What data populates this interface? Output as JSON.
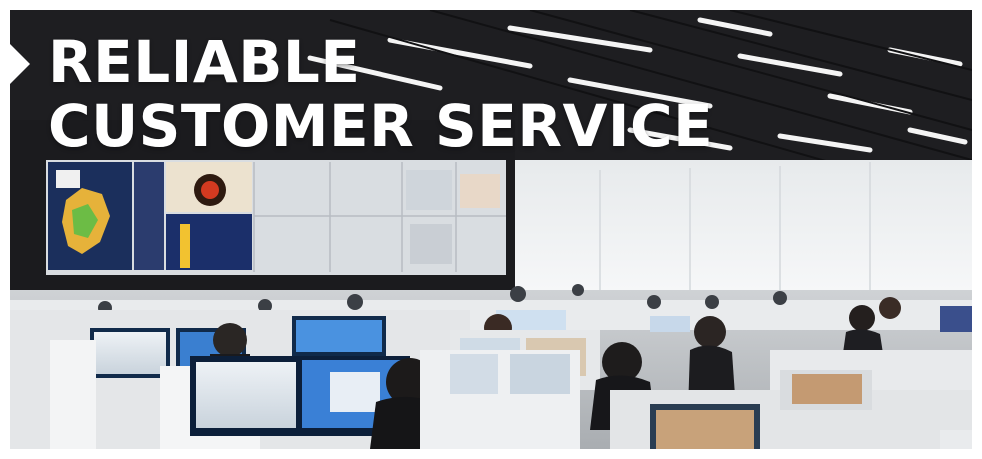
{
  "banner": {
    "headline_line1": "RELIABLE",
    "headline_line2": "CUSTOMER SERVICE",
    "photo_subject": "call center office",
    "colors": {
      "text": "#ffffff",
      "ceiling": "#1c1c1e",
      "back_wall": "#f2f4f5",
      "monitor_screen": "#3a7fd0"
    }
  }
}
